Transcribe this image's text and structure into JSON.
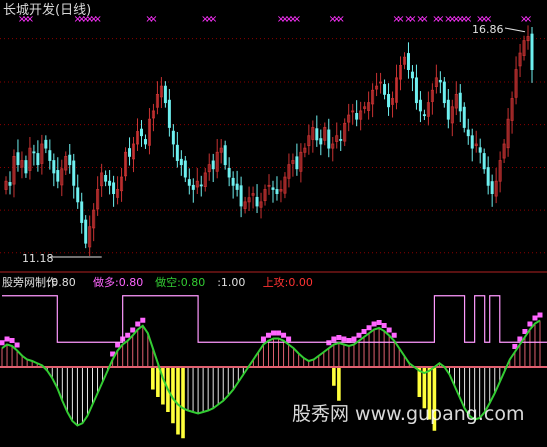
{
  "colors": {
    "background": "#000000",
    "grid": "#8b0000",
    "divider": "#b22222",
    "up_candle": "#c83232",
    "down_candle": "#6ff0f0",
    "marker": "#ff33ff",
    "title": "#d8d8d8",
    "annotation": "#e0e0e0",
    "hist_pos": "#e06070",
    "hist_neg": "#e8e8e8",
    "yellow_bar": "#ffff3c",
    "blocks": "#ff66ff",
    "step_line": "#ff99ff",
    "curve": "#33cc33",
    "watermark": "#ffffff"
  },
  "top_panel": {
    "title": "长城开发(日线)",
    "marker_glyph": "×",
    "marker_runs": [
      [
        4,
        6
      ],
      [
        18,
        23
      ],
      [
        36,
        37
      ],
      [
        50,
        52
      ],
      [
        69,
        73
      ],
      [
        82,
        84
      ],
      [
        98,
        99
      ],
      [
        101,
        102
      ],
      [
        104,
        105
      ],
      [
        108,
        109
      ],
      [
        111,
        116
      ],
      [
        119,
        121
      ],
      [
        130,
        131
      ]
    ],
    "high_label": "16.86",
    "low_label": "11.18",
    "high_point": {
      "index": 131,
      "value": 16.86
    },
    "low_point": {
      "index": 19,
      "value": 11.18
    },
    "y_range": [
      11.0,
      17.0
    ],
    "grid_levels": [
      16.55,
      15.5,
      14.47,
      13.43,
      12.4,
      11.37
    ],
    "close_series": [
      13.1,
      13.0,
      13.7,
      13.5,
      13.6,
      13.3,
      13.9,
      13.8,
      13.5,
      14.0,
      13.9,
      13.6,
      13.3,
      13.1,
      13.4,
      13.7,
      13.5,
      13.0,
      12.6,
      12.1,
      11.6,
      12.0,
      12.4,
      12.9,
      13.3,
      13.1,
      13.0,
      12.8,
      12.9,
      13.2,
      13.8,
      13.7,
      14.0,
      14.3,
      14.2,
      14.0,
      14.6,
      14.8,
      15.2,
      15.4,
      15.0,
      14.4,
      14.0,
      13.6,
      13.5,
      13.2,
      13.0,
      12.9,
      13.1,
      13.0,
      13.3,
      13.5,
      13.4,
      13.8,
      13.9,
      13.5,
      13.2,
      13.0,
      12.9,
      12.5,
      12.6,
      12.7,
      12.8,
      12.5,
      12.6,
      12.9,
      13.0,
      12.9,
      12.8,
      12.9,
      13.2,
      13.5,
      13.6,
      13.4,
      13.8,
      13.9,
      14.2,
      14.4,
      14.1,
      14.0,
      14.4,
      13.9,
      14.0,
      14.2,
      14.1,
      14.5,
      14.7,
      14.8,
      14.6,
      14.8,
      14.9,
      15.0,
      15.3,
      15.4,
      15.5,
      15.2,
      14.9,
      15.1,
      15.6,
      15.9,
      16.1,
      15.8,
      15.6,
      15.0,
      14.8,
      14.7,
      15.0,
      15.3,
      15.6,
      15.5,
      15.0,
      14.6,
      14.9,
      15.2,
      14.8,
      14.4,
      14.2,
      13.9,
      14.0,
      13.8,
      13.4,
      13.0,
      12.8,
      13.1,
      13.6,
      14.0,
      14.6,
      15.1,
      15.8,
      16.2,
      16.5,
      16.6,
      15.8
    ]
  },
  "bottom_panel": {
    "legend": [
      {
        "text": "股旁网制作",
        "color": "#e0e0e0"
      },
      {
        "text": ":0.80",
        "color": "#e0e0e0"
      },
      {
        "text": "做多:0.80",
        "color": "#ff66ff"
      },
      {
        "text": "做空:0.80",
        "color": "#33cc33"
      },
      {
        "text": ":1.00",
        "color": "#e0e0e0"
      },
      {
        "text": "上攻:0.00",
        "color": "#ff3333"
      }
    ],
    "y_range": [
      -1.0,
      1.0
    ],
    "zero_level": 0.0,
    "step_line_high": 0.95,
    "step_line_low": 0.33,
    "block_offset": 0.04,
    "curve": [
      0.25,
      0.3,
      0.28,
      0.22,
      0.15,
      0.1,
      0.08,
      0.05,
      0.02,
      -0.05,
      -0.15,
      -0.28,
      -0.45,
      -0.6,
      -0.72,
      -0.78,
      -0.75,
      -0.65,
      -0.5,
      -0.35,
      -0.2,
      -0.05,
      0.1,
      0.22,
      0.3,
      0.35,
      0.42,
      0.5,
      0.55,
      0.45,
      0.25,
      0.05,
      -0.15,
      -0.3,
      -0.42,
      -0.5,
      -0.55,
      -0.58,
      -0.6,
      -0.62,
      -0.6,
      -0.58,
      -0.55,
      -0.5,
      -0.45,
      -0.38,
      -0.3,
      -0.2,
      -0.1,
      0.0,
      0.1,
      0.2,
      0.3,
      0.35,
      0.38,
      0.38,
      0.35,
      0.3,
      0.25,
      0.18,
      0.12,
      0.08,
      0.1,
      0.15,
      0.2,
      0.25,
      0.3,
      0.32,
      0.3,
      0.28,
      0.3,
      0.35,
      0.4,
      0.45,
      0.5,
      0.52,
      0.48,
      0.42,
      0.35,
      0.25,
      0.15,
      0.05,
      0.0,
      -0.05,
      -0.08,
      -0.05,
      0.0,
      0.05,
      0.0,
      -0.1,
      -0.25,
      -0.4,
      -0.55,
      -0.65,
      -0.7,
      -0.68,
      -0.6,
      -0.48,
      -0.35,
      -0.2,
      -0.05,
      0.1,
      0.2,
      0.3,
      0.4,
      0.5,
      0.58,
      0.62
    ],
    "step_line": [
      0.95,
      0.95,
      0.95,
      0.95,
      0.95,
      0.95,
      0.95,
      0.95,
      0.95,
      0.95,
      0.95,
      0.33,
      0.33,
      0.33,
      0.33,
      0.33,
      0.33,
      0.33,
      0.33,
      0.33,
      0.33,
      0.33,
      0.33,
      0.33,
      0.95,
      0.95,
      0.95,
      0.95,
      0.95,
      0.95,
      0.95,
      0.95,
      0.95,
      0.95,
      0.95,
      0.95,
      0.95,
      0.95,
      0.95,
      0.33,
      0.33,
      0.33,
      0.33,
      0.33,
      0.33,
      0.33,
      0.33,
      0.33,
      0.33,
      0.33,
      0.33,
      0.33,
      0.33,
      0.33,
      0.33,
      0.33,
      0.33,
      0.33,
      0.33,
      0.33,
      0.33,
      0.33,
      0.33,
      0.33,
      0.33,
      0.33,
      0.33,
      0.33,
      0.33,
      0.33,
      0.33,
      0.33,
      0.33,
      0.33,
      0.33,
      0.33,
      0.33,
      0.33,
      0.33,
      0.33,
      0.33,
      0.33,
      0.33,
      0.33,
      0.33,
      0.33,
      0.95,
      0.95,
      0.95,
      0.95,
      0.95,
      0.95,
      0.33,
      0.33,
      0.95,
      0.95,
      0.33,
      0.95,
      0.95,
      0.33,
      0.33,
      0.33,
      0.33,
      0.33,
      0.33,
      0.33,
      0.33,
      0.33,
      0.33,
      0.33,
      0.33,
      0.33,
      0.33,
      0.33,
      0.33,
      0.95,
      0.95,
      0.95,
      0.95,
      0.95,
      0.95
    ],
    "pink_blocks": [
      1,
      1,
      1,
      1,
      0,
      0,
      0,
      0,
      0,
      0,
      0,
      0,
      0,
      0,
      0,
      0,
      0,
      0,
      0,
      0,
      0,
      0,
      1,
      1,
      1,
      1,
      1,
      1,
      1,
      0,
      0,
      0,
      0,
      0,
      0,
      0,
      0,
      0,
      0,
      0,
      0,
      0,
      0,
      0,
      0,
      0,
      0,
      0,
      0,
      0,
      0,
      0,
      1,
      1,
      1,
      1,
      1,
      1,
      0,
      0,
      0,
      0,
      0,
      0,
      0,
      1,
      1,
      1,
      1,
      1,
      1,
      1,
      1,
      1,
      1,
      1,
      1,
      1,
      1,
      0,
      0,
      0,
      0,
      0,
      0,
      0,
      0,
      0,
      0,
      0,
      0,
      0,
      0,
      0,
      0,
      0,
      0,
      0,
      0,
      0,
      0,
      0,
      1,
      1,
      1,
      1,
      1,
      1
    ],
    "yellow_bars": [
      0,
      0,
      0,
      0,
      0,
      0,
      0,
      0,
      0,
      0,
      0,
      0,
      0,
      0,
      0,
      0,
      0,
      0,
      0,
      0,
      0,
      0,
      0,
      0,
      0,
      0,
      0,
      0,
      0,
      0,
      -0.3,
      -0.4,
      -0.5,
      -0.6,
      -0.75,
      -0.9,
      -0.95,
      0,
      0,
      0,
      0,
      0,
      0,
      0,
      0,
      0,
      0,
      0,
      0,
      0,
      0,
      0,
      0,
      0,
      0,
      0,
      0,
      0,
      0,
      0,
      0,
      0,
      0,
      0,
      0,
      0,
      -0.25,
      -0.45,
      0,
      0,
      0,
      0,
      0,
      0,
      0,
      0,
      0,
      0,
      0,
      0,
      0,
      0,
      0,
      -0.4,
      -0.55,
      -0.7,
      -0.85,
      0,
      0,
      0,
      0,
      0,
      0,
      0,
      0,
      0,
      0,
      0,
      0,
      0,
      0,
      0,
      0,
      0,
      0,
      0,
      0,
      0,
      0,
      0,
      0,
      0,
      0,
      -0.35,
      -0.5,
      -0.65,
      -0.8
    ]
  },
  "watermark": "股秀网 www.gupang.com"
}
